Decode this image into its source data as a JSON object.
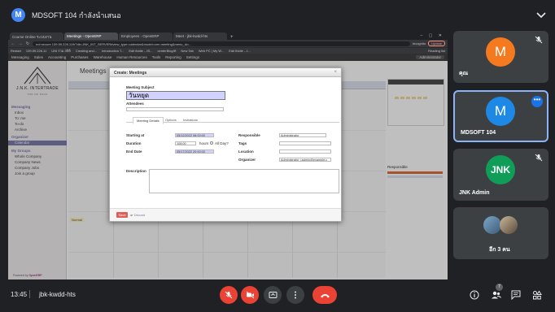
{
  "meet": {
    "presenter_initial": "M",
    "presenting_title": "MDSOFT 104 กำลังนำเสนอ",
    "time": "13:45",
    "meeting_code": "jbk-kwdd-hts",
    "participant_badge": "7"
  },
  "participants": [
    {
      "initial": "M",
      "name": "คุณ",
      "color": "#f4791f"
    },
    {
      "initial": "M",
      "name": "MDSOFT 104",
      "color": "#1e88e5"
    },
    {
      "initial": "JNK",
      "name": "JNK Admin",
      "color": "#0f9d58"
    },
    {
      "initial": "",
      "name": "อีก 3 คน",
      "color": "#5f6368"
    }
  ],
  "browser": {
    "tabs": [
      "Course Online ระบบงาน",
      "Meetings - OpenERP",
      "Employees - OpenERP",
      "Meet - jbk-kwdd-hts"
    ],
    "url": "not secure   139.59.226.119/?db=JNK_INT_SERVER#view_type=calendar&model=crm.meeting&menu_id=...",
    "incognito_label": "Incognito",
    "update_label": "Update",
    "bookmarks": [
      "Restart",
      "139.59.226.11",
      "UNI รวม สถิติ",
      "Creating and...",
      "Introduction T...",
      "Edit fiddle - JS...",
      "centerBlog/ท",
      "New Tab",
      "Web PC | My W...",
      "Edit fiddle - J..."
    ],
    "reading_list": "Reading list"
  },
  "erp": {
    "top_menu": [
      "Messaging",
      "Sales",
      "Accounting",
      "Purchases",
      "Warehouse",
      "Human Resources",
      "Tools",
      "Reporting",
      "Settings"
    ],
    "user": "Administrator",
    "logo_name": "J.N.K. INTERTRADE",
    "logo_tagline": "TOP OF PACK",
    "left_menu": {
      "section1": "Messaging",
      "items1": [
        "Inbox",
        "To: me",
        "To-do",
        "Archive"
      ],
      "section2": "Organizer",
      "active_item": "Calendar",
      "section3": "My Groups",
      "items3": [
        "Whole Company",
        "Company News",
        "Company Jobs",
        "Join a group"
      ]
    },
    "powered_by": "Powered by",
    "powered_brand": "OpenERP",
    "view_title": "Meetings",
    "normal_label": "Normal",
    "responsible_heading": "Responsible"
  },
  "dialog": {
    "title": "Create: Meetings",
    "close": "×",
    "subject_label": "Meeting Subject",
    "subject_value": "วันหยุด",
    "attendees_label": "Attendees",
    "tabs": [
      "Meeting Details",
      "Options",
      "Invitations"
    ],
    "starting_at_label": "Starting at",
    "starting_at_value": "05/12/2022 08:00:00",
    "duration_label": "Duration",
    "duration_value": "108:00",
    "hours_label": "hours",
    "allday_label": "All Day?",
    "end_date_label": "End Date",
    "end_date_value": "05/17/2022 20:00:00",
    "responsible_label": "Responsible",
    "responsible_value": "Administrator",
    "tags_label": "Tags",
    "location_label": "Location",
    "organizer_label": "Organizer",
    "organizer_value": "Administrator <admin@example.c",
    "description_label": "Description",
    "save_label": "Save",
    "or_label": "or",
    "discard_label": "Discard"
  }
}
